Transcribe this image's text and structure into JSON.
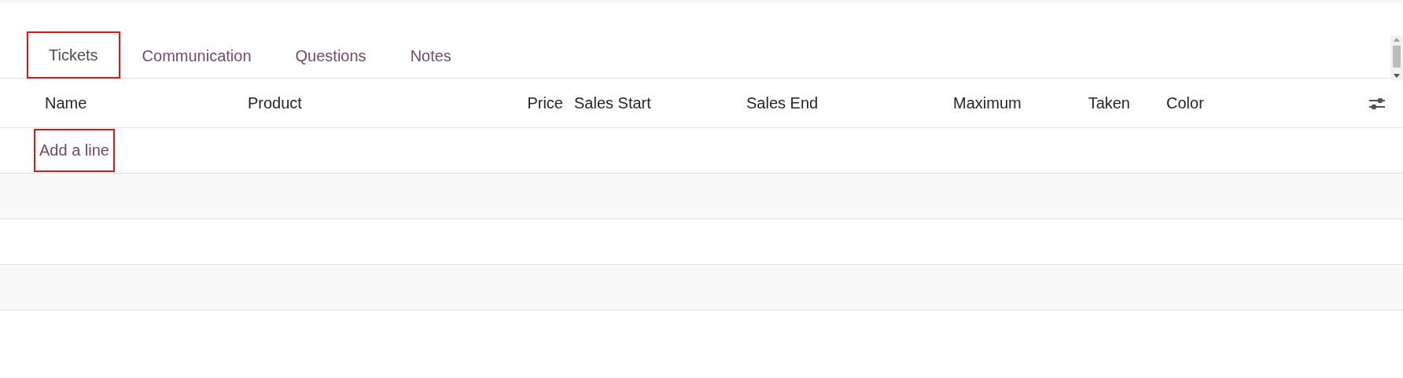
{
  "tabs": [
    {
      "label": "Tickets",
      "selected": true,
      "highlighted": true
    },
    {
      "label": "Communication",
      "selected": false,
      "highlighted": false
    },
    {
      "label": "Questions",
      "selected": false,
      "highlighted": false
    },
    {
      "label": "Notes",
      "selected": false,
      "highlighted": false
    }
  ],
  "table": {
    "columns": [
      {
        "label": "Name"
      },
      {
        "label": "Product"
      },
      {
        "label": "Price"
      },
      {
        "label": "Sales Start"
      },
      {
        "label": "Sales End"
      },
      {
        "label": "Maximum"
      },
      {
        "label": "Taken"
      },
      {
        "label": "Color"
      }
    ],
    "add_line": {
      "label": "Add a line",
      "highlighted": true
    }
  }
}
